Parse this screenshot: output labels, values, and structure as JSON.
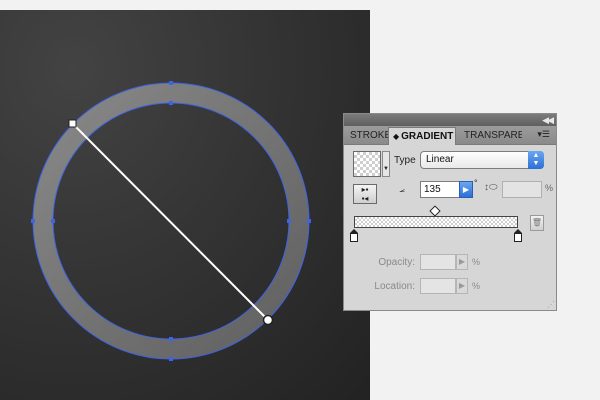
{
  "panel": {
    "collapse_icon": "double-chevron-left-icon",
    "tabs": [
      {
        "label": "STROKE"
      },
      {
        "label": "GRADIENT",
        "active": true
      },
      {
        "label": "TRANSPARE"
      }
    ],
    "menu_icon": "panel-menu-icon",
    "type": {
      "label": "Type",
      "value": "Linear"
    },
    "angle": {
      "value": "135",
      "unit": "°"
    },
    "aspect": {
      "value": "",
      "unit": "%"
    },
    "opacity": {
      "label": "Opacity:",
      "value": "",
      "unit": "%"
    },
    "location": {
      "label": "Location:",
      "value": "",
      "unit": "%"
    },
    "colors": {
      "accent": "#2c6fd6",
      "panel_bg": "#d6d6d6"
    }
  },
  "artboard": {
    "colors": {
      "background": "#2b2a2a",
      "selection": "#3d63e8",
      "ring": "#7a7a7a"
    }
  }
}
